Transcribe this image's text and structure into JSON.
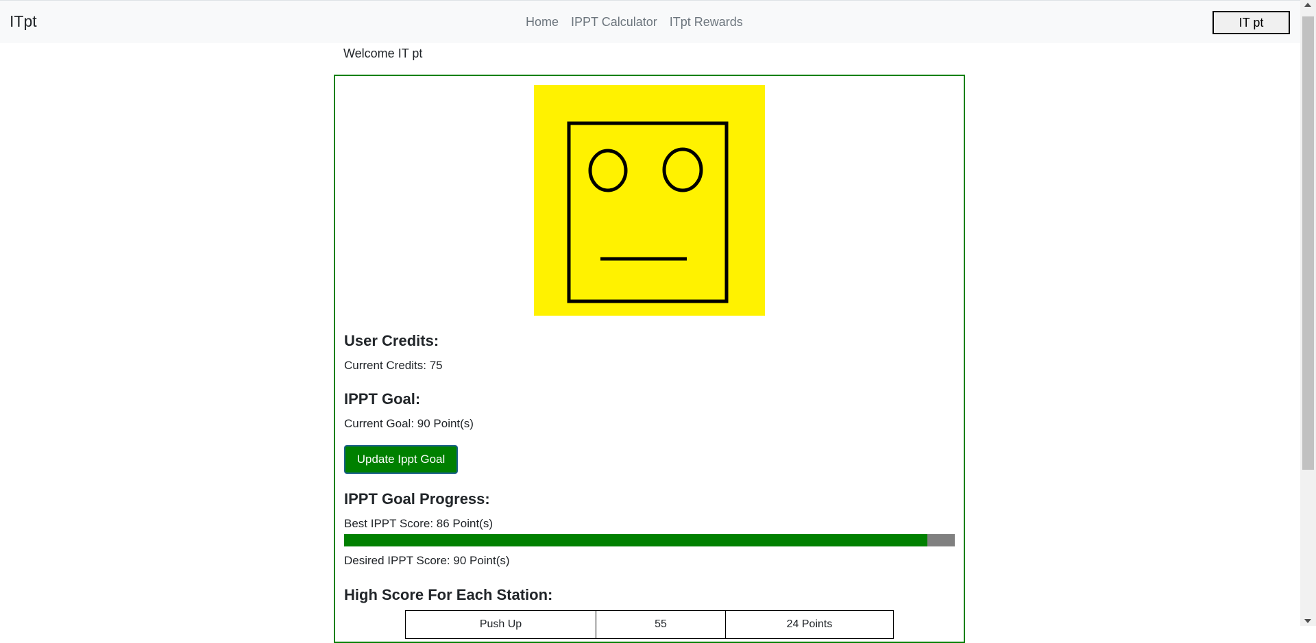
{
  "navbar": {
    "brand": "ITpt",
    "links": [
      "Home",
      "IPPT Calculator",
      "ITpt Rewards"
    ],
    "user_button": "IT pt"
  },
  "welcome": "Welcome IT pt",
  "avatar": {
    "background": "#FFF200",
    "stroke": "#000000",
    "expression": "neutral"
  },
  "credits": {
    "title": "User Credits:",
    "text": "Current Credits: 75"
  },
  "goal": {
    "title": "IPPT Goal:",
    "text": "Current Goal: 90 Point(s)",
    "button": "Update Ippt Goal"
  },
  "progress": {
    "title": "IPPT Goal Progress:",
    "best": "Best IPPT Score: 86 Point(s)",
    "desired": "Desired IPPT Score: 90 Point(s)",
    "fraction": 0.9556
  },
  "stations": {
    "title": "High Score For Each Station:",
    "rows": [
      [
        "Push Up",
        "55",
        "24 Points"
      ]
    ]
  },
  "colors": {
    "accent": "#008000",
    "progress_remaining": "#808080"
  }
}
